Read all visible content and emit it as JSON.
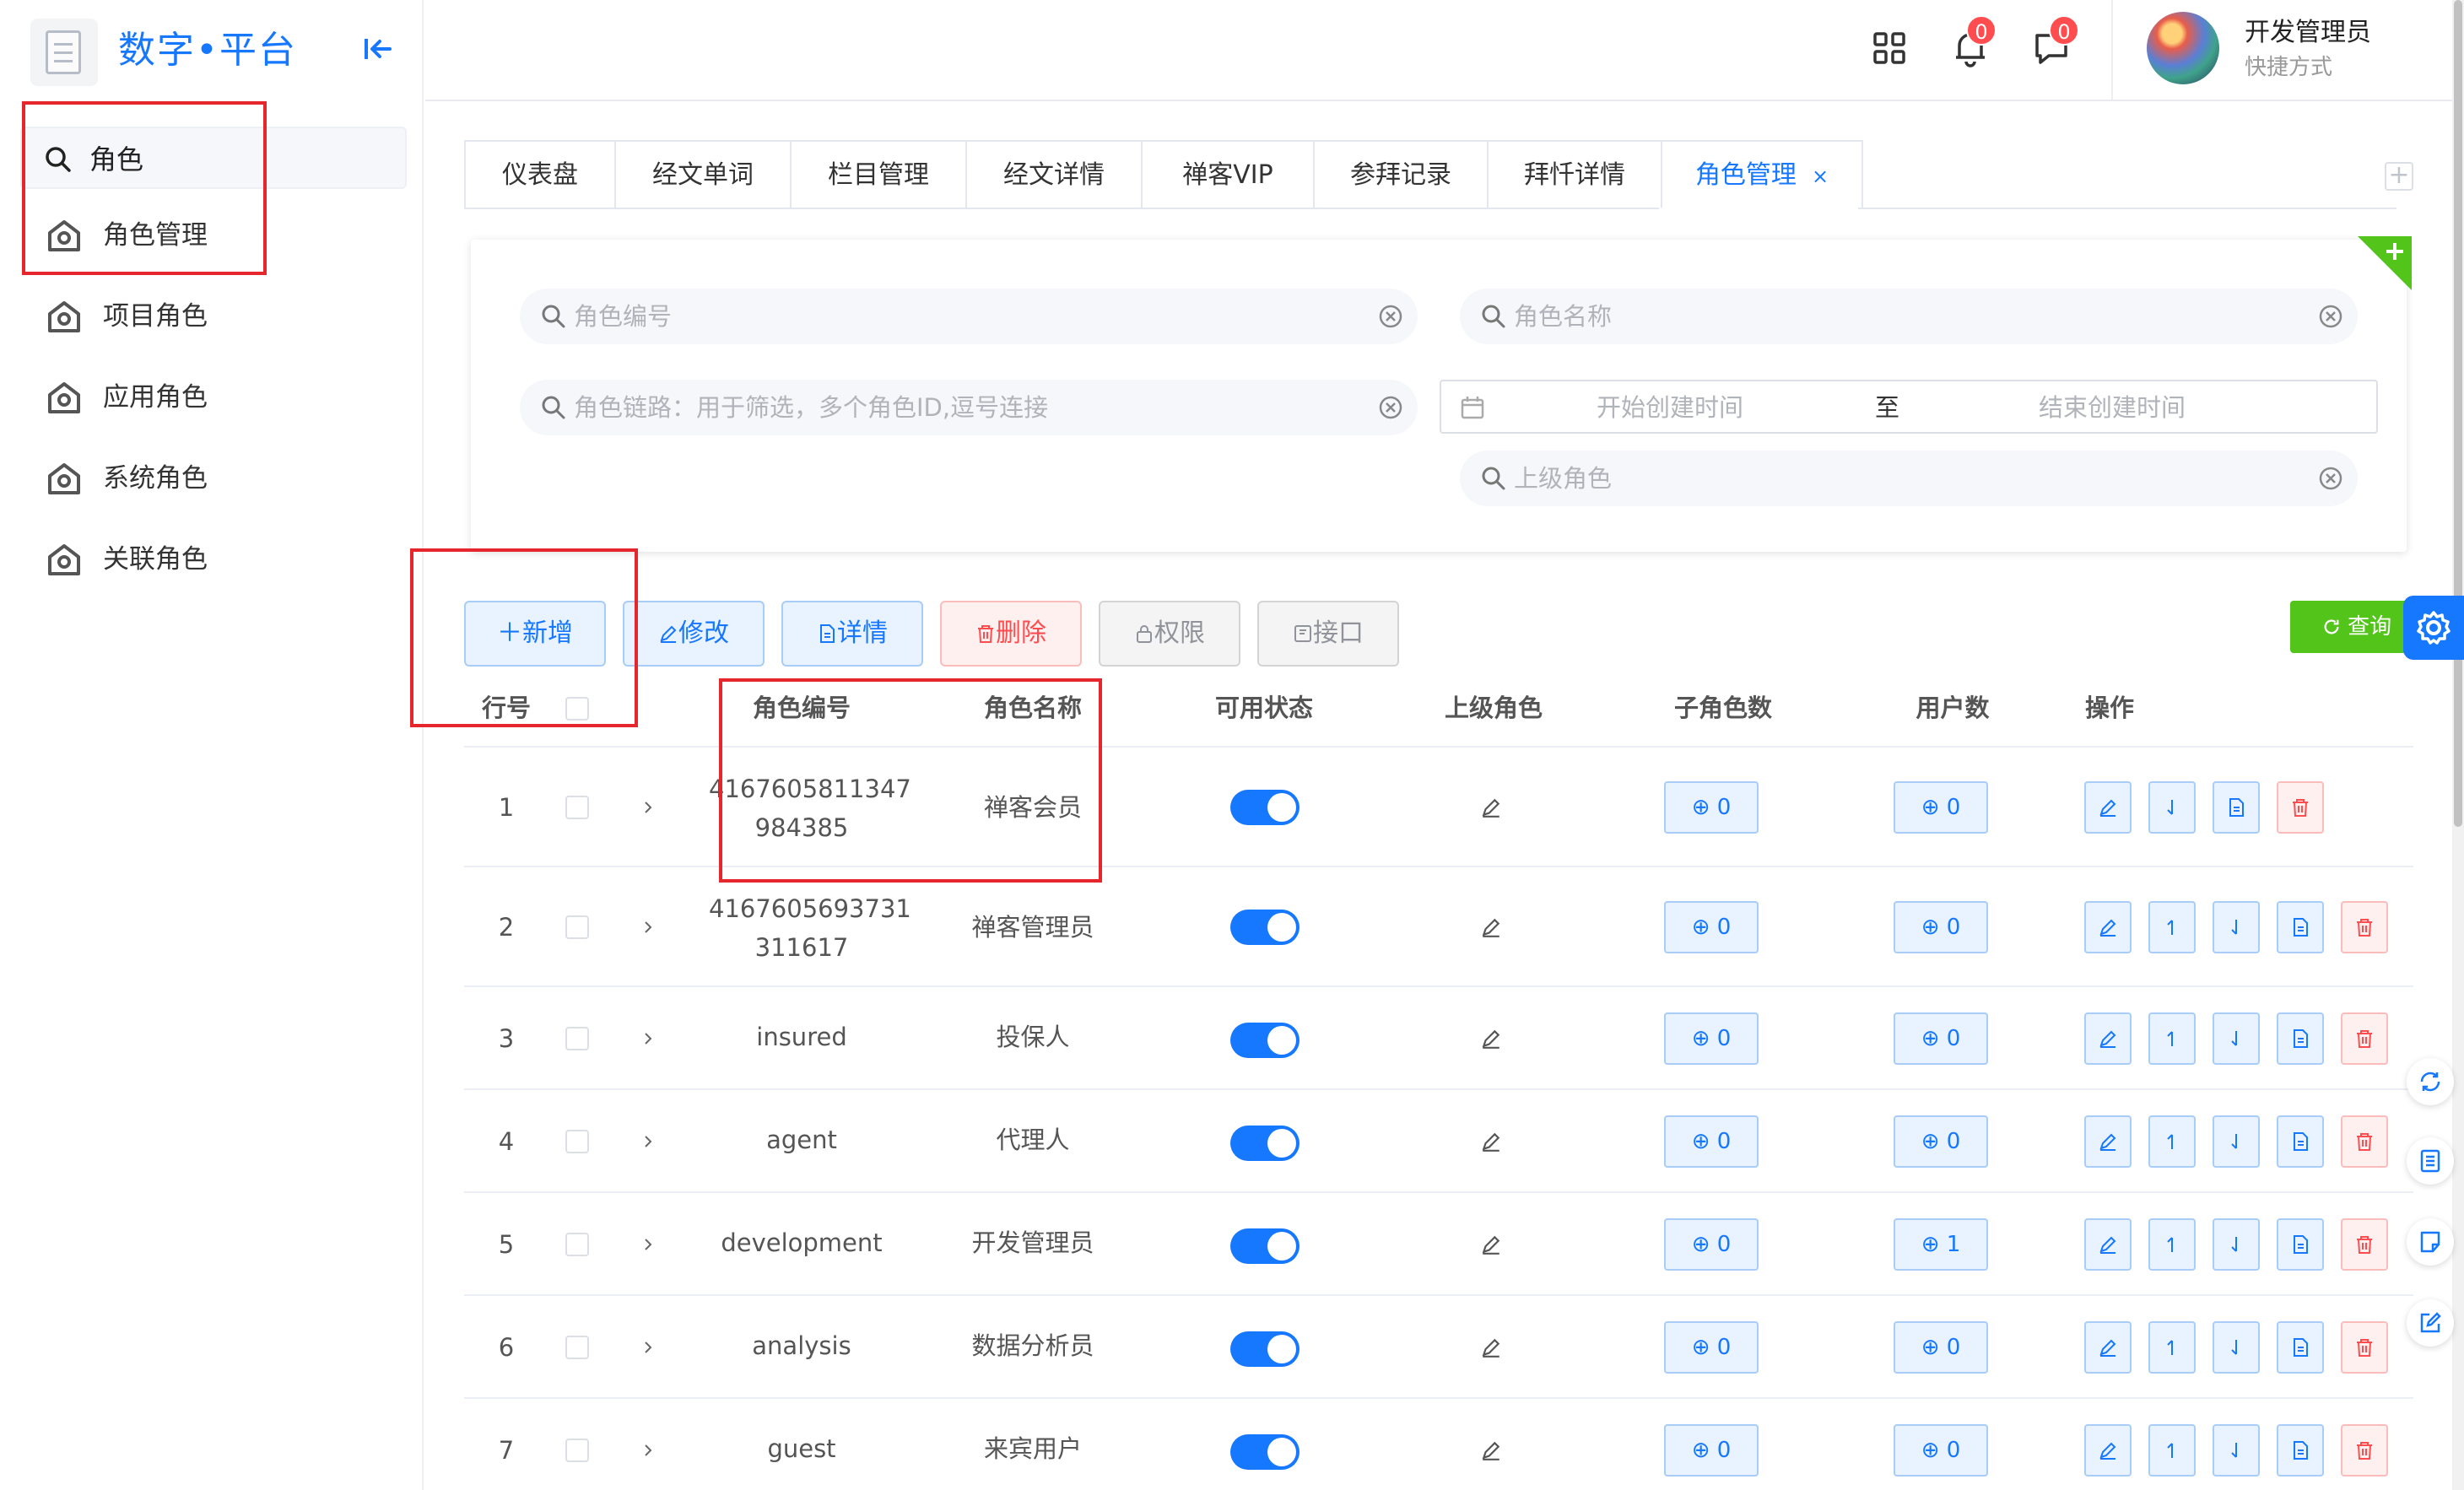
{
  "app": {
    "title": "数字•平台"
  },
  "sidebar": {
    "search_value": "角色",
    "items": [
      {
        "label": "角色管理"
      },
      {
        "label": "项目角色"
      },
      {
        "label": "应用角色"
      },
      {
        "label": "系统角色"
      },
      {
        "label": "关联角色"
      }
    ]
  },
  "topbar": {
    "notification_count": "0",
    "message_count": "0",
    "user_name": "开发管理员",
    "user_sub": "快捷方式"
  },
  "tabs": [
    {
      "label": "仪表盘"
    },
    {
      "label": "经文单词"
    },
    {
      "label": "栏目管理"
    },
    {
      "label": "经文详情"
    },
    {
      "label": "禅客VIP"
    },
    {
      "label": "参拜记录"
    },
    {
      "label": "拜忏详情"
    },
    {
      "label": "角色管理",
      "close": "×"
    }
  ],
  "filters": {
    "role_code_ph": "角色编号",
    "role_name_ph": "角色名称",
    "role_chain_ph": "角色链路：用于筛选，多个角色ID,逗号连接",
    "start_time_ph": "开始创建时间",
    "range_sep": "至",
    "end_time_ph": "结束创建时间",
    "parent_role_ph": "上级角色"
  },
  "actions": {
    "add": "＋新增",
    "edit": "修改",
    "detail": "详情",
    "delete": "删除",
    "permission": "权限",
    "api": "接口",
    "query": "查询"
  },
  "table": {
    "headers": {
      "row_no": "行号",
      "code": "角色编号",
      "name": "角色名称",
      "status": "可用状态",
      "parent": "上级角色",
      "children": "子角色数",
      "users": "用户数",
      "ops": "操作"
    },
    "rows": [
      {
        "no": "1",
        "code1": "4167605811347",
        "code2": "984385",
        "name": "禅客会员",
        "children": "⊕ 0",
        "users": "⊕ 0"
      },
      {
        "no": "2",
        "code1": "4167605693731",
        "code2": "311617",
        "name": "禅客管理员",
        "children": "⊕ 0",
        "users": "⊕ 0"
      },
      {
        "no": "3",
        "code1": "insured",
        "code2": "",
        "name": "投保人",
        "children": "⊕ 0",
        "users": "⊕ 0"
      },
      {
        "no": "4",
        "code1": "agent",
        "code2": "",
        "name": "代理人",
        "children": "⊕ 0",
        "users": "⊕ 0"
      },
      {
        "no": "5",
        "code1": "development",
        "code2": "",
        "name": "开发管理员",
        "children": "⊕ 0",
        "users": "⊕ 1"
      },
      {
        "no": "6",
        "code1": "analysis",
        "code2": "",
        "name": "数据分析员",
        "children": "⊕ 0",
        "users": "⊕ 0"
      },
      {
        "no": "7",
        "code1": "guest",
        "code2": "",
        "name": "来宾用户",
        "children": "⊕ 0",
        "users": "⊕ 0"
      }
    ]
  },
  "colors": {
    "primary": "#1677ff",
    "danger": "#ff4d4f",
    "success": "#52c41a",
    "annotation": "#e5272d"
  }
}
